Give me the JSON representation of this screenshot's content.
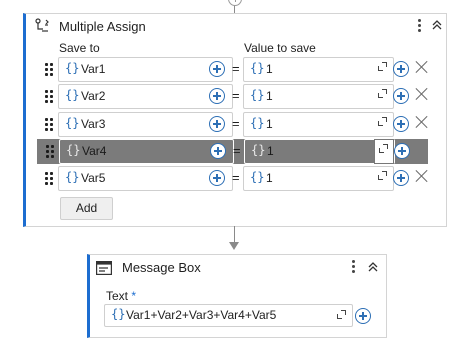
{
  "multiple_assign": {
    "title": "Multiple Assign",
    "save_to_label": "Save to",
    "value_to_save_label": "Value to save",
    "rows": [
      {
        "variable": "Var1",
        "value": "1",
        "selected": false
      },
      {
        "variable": "Var2",
        "value": "1",
        "selected": false
      },
      {
        "variable": "Var3",
        "value": "1",
        "selected": false
      },
      {
        "variable": "Var4",
        "value": "1",
        "selected": true
      },
      {
        "variable": "Var5",
        "value": "1",
        "selected": false
      }
    ],
    "equals_sign": "=",
    "add_button_label": "Add"
  },
  "message_box": {
    "title": "Message Box",
    "text_label": "Text",
    "required_marker": "*",
    "text_value": "Var1+Var2+Var3+Var4+Var5"
  },
  "icons": {
    "expression": "{}",
    "assign": "multiple-assign-icon",
    "message_box": "message-box-icon"
  },
  "colors": {
    "accent": "#1c6dd0",
    "selected_row": "#7b7b7b"
  }
}
